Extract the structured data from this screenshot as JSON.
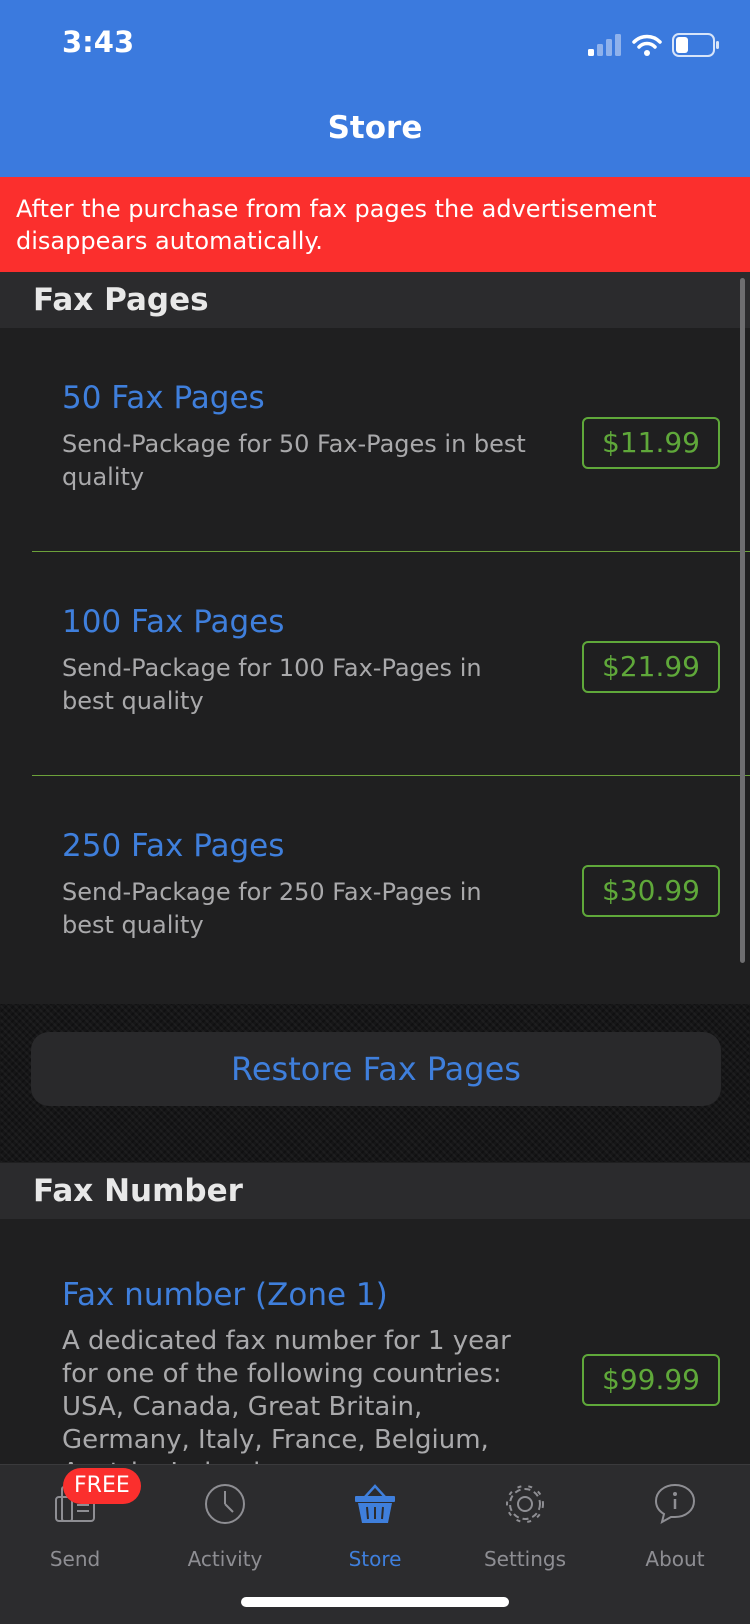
{
  "status_bar": {
    "time": "3:43"
  },
  "header": {
    "title": "Store"
  },
  "banner": {
    "text": "After the purchase from fax pages the advertisement disappears automatically."
  },
  "fax_pages_section": {
    "title": "Fax Pages",
    "items": [
      {
        "title": "50 Fax Pages",
        "description": "Send-Package for 50 Fax-Pages in best quality",
        "price": "$11.99"
      },
      {
        "title": "100 Fax Pages",
        "description": "Send-Package for 100 Fax-Pages in best quality",
        "price": "$21.99"
      },
      {
        "title": "250 Fax Pages",
        "description": "Send-Package for 250 Fax-Pages in best quality",
        "price": "$30.99"
      }
    ],
    "restore_label": "Restore Fax Pages"
  },
  "fax_number_section": {
    "title": "Fax Number",
    "items": [
      {
        "title": "Fax number (Zone 1)",
        "description": "A dedicated fax number for 1 year for one of the following countries: USA, Canada, Great Britain, Germany, Italy, France, Belgium, Austria, Ireland,",
        "price": "$99.99"
      }
    ]
  },
  "tabbar": {
    "free_badge": "FREE",
    "tabs": [
      {
        "label": "Send",
        "icon": "fax-machine-icon",
        "active": false
      },
      {
        "label": "Activity",
        "icon": "clock-icon",
        "active": false
      },
      {
        "label": "Store",
        "icon": "basket-icon",
        "active": true
      },
      {
        "label": "Settings",
        "icon": "gear-icon",
        "active": false
      },
      {
        "label": "About",
        "icon": "info-bubble-icon",
        "active": false
      }
    ]
  },
  "colors": {
    "header_blue": "#3b7ade",
    "banner_red": "#fb2f2d",
    "link_blue": "#3f7fdc",
    "price_green": "#5fa83a",
    "background": "#1f1f20"
  }
}
